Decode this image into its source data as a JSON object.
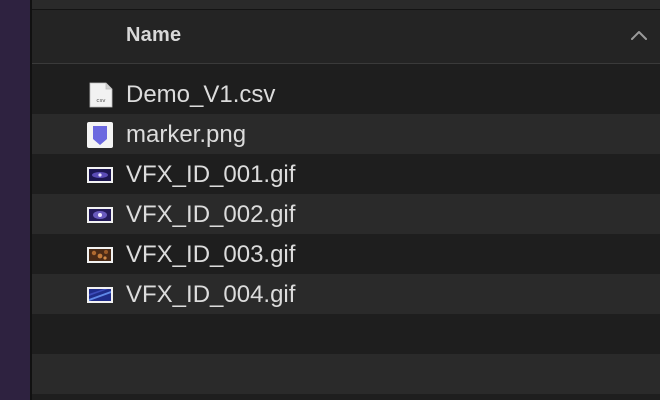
{
  "header": {
    "column_label": "Name",
    "sort_icon": "chevron-up-icon"
  },
  "files": [
    {
      "name": "Demo_V1.csv",
      "icon": "csv-file-icon",
      "icon_text": "csv"
    },
    {
      "name": "marker.png",
      "icon": "png-image-icon"
    },
    {
      "name": "VFX_ID_001.gif",
      "icon": "gif-thumbnail-icon"
    },
    {
      "name": "VFX_ID_002.gif",
      "icon": "gif-thumbnail-icon"
    },
    {
      "name": "VFX_ID_003.gif",
      "icon": "gif-thumbnail-icon"
    },
    {
      "name": "VFX_ID_004.gif",
      "icon": "gif-thumbnail-icon"
    }
  ],
  "colors": {
    "sidebar": "#2e2240",
    "row_alt": "#2a2a2a",
    "row_base": "#1e1e1e",
    "text": "#dcdcdc",
    "marker_icon": "#6b68e0"
  }
}
